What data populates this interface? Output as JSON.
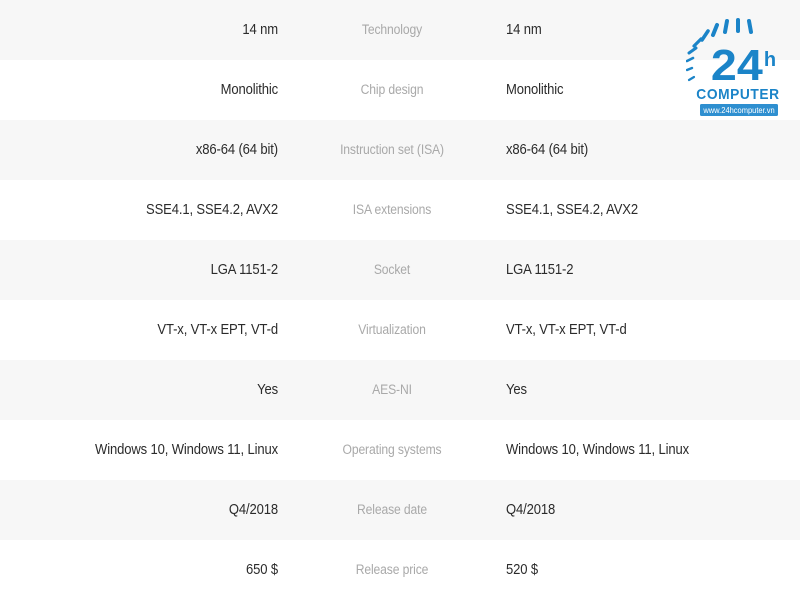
{
  "table": {
    "columns": [
      "cpu_a_value",
      "spec_label",
      "cpu_b_value"
    ],
    "rows": [
      {
        "left": "14 nm",
        "label": "Technology",
        "right": "14 nm"
      },
      {
        "left": "Monolithic",
        "label": "Chip design",
        "right": "Monolithic"
      },
      {
        "left": "x86-64 (64 bit)",
        "label": "Instruction set (ISA)",
        "right": "x86-64 (64 bit)"
      },
      {
        "left": "SSE4.1, SSE4.2, AVX2",
        "label": "ISA extensions",
        "right": "SSE4.1, SSE4.2, AVX2"
      },
      {
        "left": "LGA 1151-2",
        "label": "Socket",
        "right": "LGA 1151-2"
      },
      {
        "left": "VT-x, VT-x EPT, VT-d",
        "label": "Virtualization",
        "right": "VT-x, VT-x EPT, VT-d"
      },
      {
        "left": "Yes",
        "label": "AES-NI",
        "right": "Yes"
      },
      {
        "left": "Windows 10, Windows 11, Linux",
        "label": "Operating systems",
        "right": "Windows 10, Windows 11, Linux"
      },
      {
        "left": "Q4/2018",
        "label": "Release date",
        "right": "Q4/2018"
      },
      {
        "left": "650 $",
        "label": "Release price",
        "right": "520 $"
      }
    ]
  },
  "watermark": {
    "number": "24",
    "hour_suffix": "h",
    "brand": "COMPUTER",
    "url": "www.24hcomputer.vn"
  },
  "colors": {
    "value_text": "#2b2b2b",
    "label_text": "#a9a9a9",
    "row_shaded": "#f7f7f7",
    "row_plain": "#ffffff",
    "logo_blue": "#1b84c8",
    "logo_blue_dark": "#0f6ba8"
  }
}
